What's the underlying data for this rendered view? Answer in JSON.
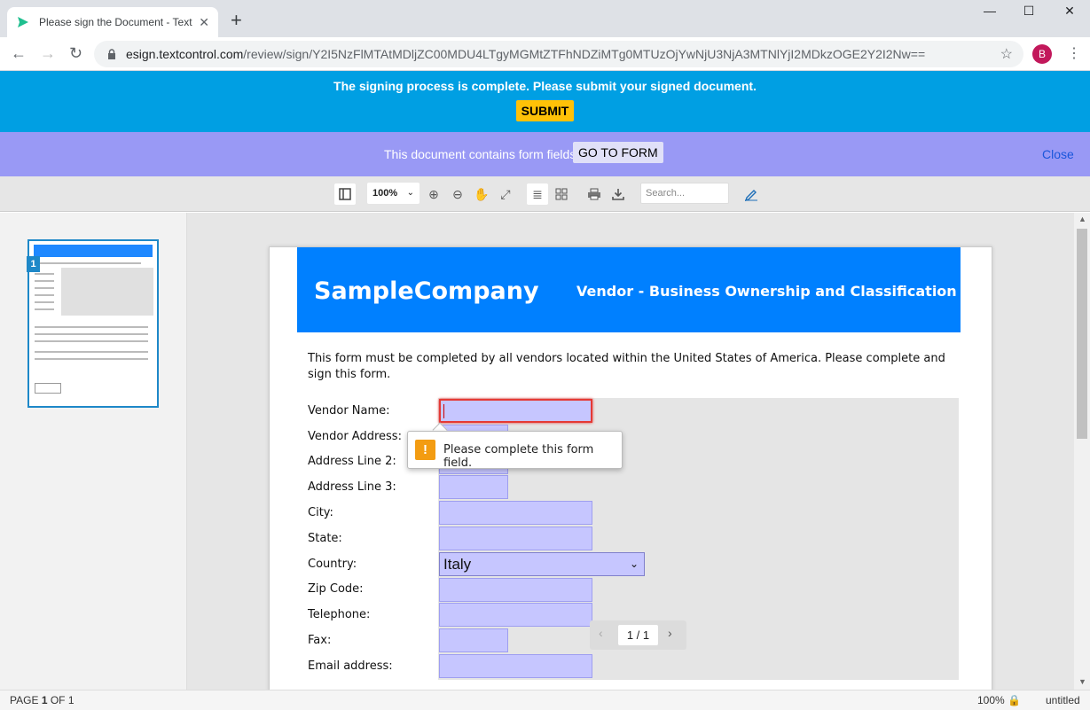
{
  "browser": {
    "tab_title": "Please sign the Document - Text C",
    "url_host": "esign.textcontrol.com",
    "url_path": "/review/sign/Y2I5NzFlMTAtMDljZC00MDU4LTgyMGMtZTFhNDZiMTg0MTUzOjYwNjU3NjA3MTNlYjI2MDkzOGE2Y2I2Nw==",
    "profile_initial": "B"
  },
  "banner": {
    "complete_message": "The signing process is complete. Please submit your signed document.",
    "submit_label": "SUBMIT",
    "form_fields_message": "This document contains form fields.",
    "goto_form_label": "GO TO FORM",
    "close_label": "Close"
  },
  "toolbar": {
    "zoom_value": "100%",
    "search_placeholder": "Search..."
  },
  "sidebar": {
    "page_number": "1"
  },
  "document": {
    "company": "SampleCompany",
    "title": "Vendor - Business Ownership and Classification",
    "intro": "This form must be completed by all vendors located within the United States of America. Please complete and sign this form.",
    "fields": [
      {
        "label": "Vendor Name:"
      },
      {
        "label": "Vendor Address:"
      },
      {
        "label": "Address Line 2:"
      },
      {
        "label": "Address Line 3:"
      },
      {
        "label": "City:"
      },
      {
        "label": "State:"
      },
      {
        "label": "Country:"
      },
      {
        "label": "Zip Code:"
      },
      {
        "label": "Telephone:"
      },
      {
        "label": "Fax:"
      },
      {
        "label": "Email address:"
      }
    ],
    "country_value": "Italy",
    "validation_message": "Please complete this form field."
  },
  "pager": {
    "text": "1 / 1"
  },
  "status": {
    "page_prefix": "PAGE",
    "page_current": "1",
    "page_of": "OF 1",
    "zoom": "100%",
    "doc_name": "untitled"
  },
  "colors": {
    "banner_blue": "#009fe3",
    "banner_purple": "#9999f5",
    "submit": "#ffc107",
    "doc_header": "#0080ff",
    "field_fill": "#c6c6ff",
    "error": "#e53935"
  }
}
